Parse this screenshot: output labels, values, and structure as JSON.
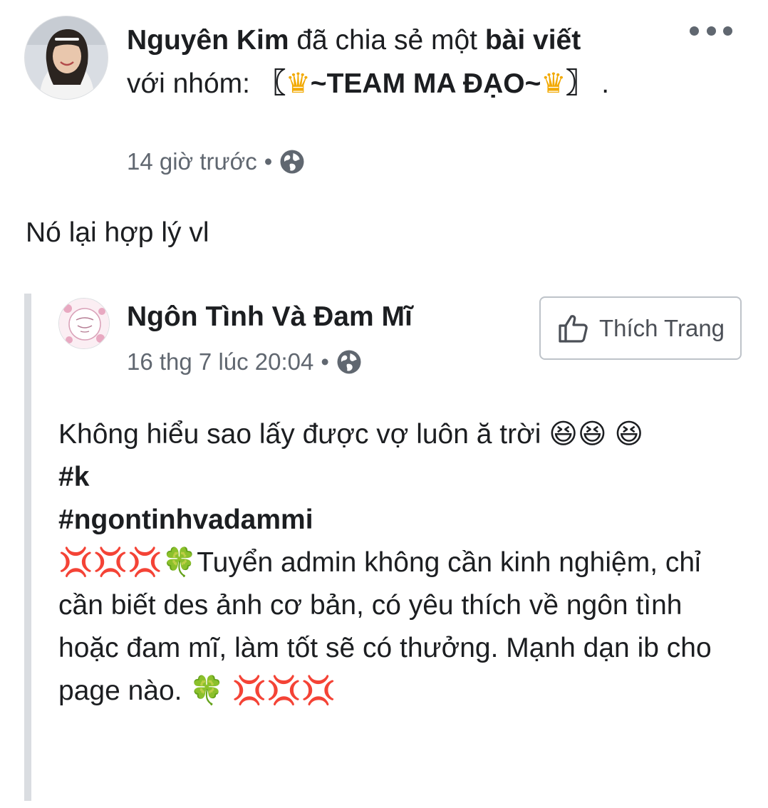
{
  "post": {
    "author": "Nguyên Kim",
    "action_text": " đã chia sẻ một ",
    "shared_object": "bài viết",
    "group_intro": " với nhóm: ",
    "group_bracket_open": "〖",
    "group_name_part1": "~TEAM MA ĐẠO~",
    "group_bracket_close": "〗",
    "trailing": " .",
    "timestamp": "14 giờ trước",
    "separator": "•",
    "privacy_icon": "globe-icon",
    "menu_icon": "more-dots-icon",
    "message": "Nó lại hợp lý vl"
  },
  "shared": {
    "page_name": "Ngôn Tình Và Đam Mĩ",
    "timestamp": "16 thg 7 lúc 20:04",
    "separator": "•",
    "like_button_label": "Thích Trang",
    "like_button_icon": "thumbs-up-icon",
    "body_line1": "Không hiểu sao lấy được vợ luôn ă trời ",
    "laugh_emoji": "😆",
    "hashtags": [
      "#k",
      "#ngontinhvadammi"
    ],
    "anger_emoji": "💢",
    "clover_emoji": "🍀",
    "recruit_text": "Tuyển admin không cần kinh nghiệm, chỉ cần biết des ảnh cơ bản, có yêu thích về ngôn tình hoặc đam mĩ, làm tốt sẽ có thưởng. Mạnh dạn ib cho page nào. "
  },
  "colors": {
    "text_primary": "#1c1e21",
    "text_secondary": "#606770",
    "share_bar": "#dadde1",
    "button_border": "#bec3c9"
  }
}
